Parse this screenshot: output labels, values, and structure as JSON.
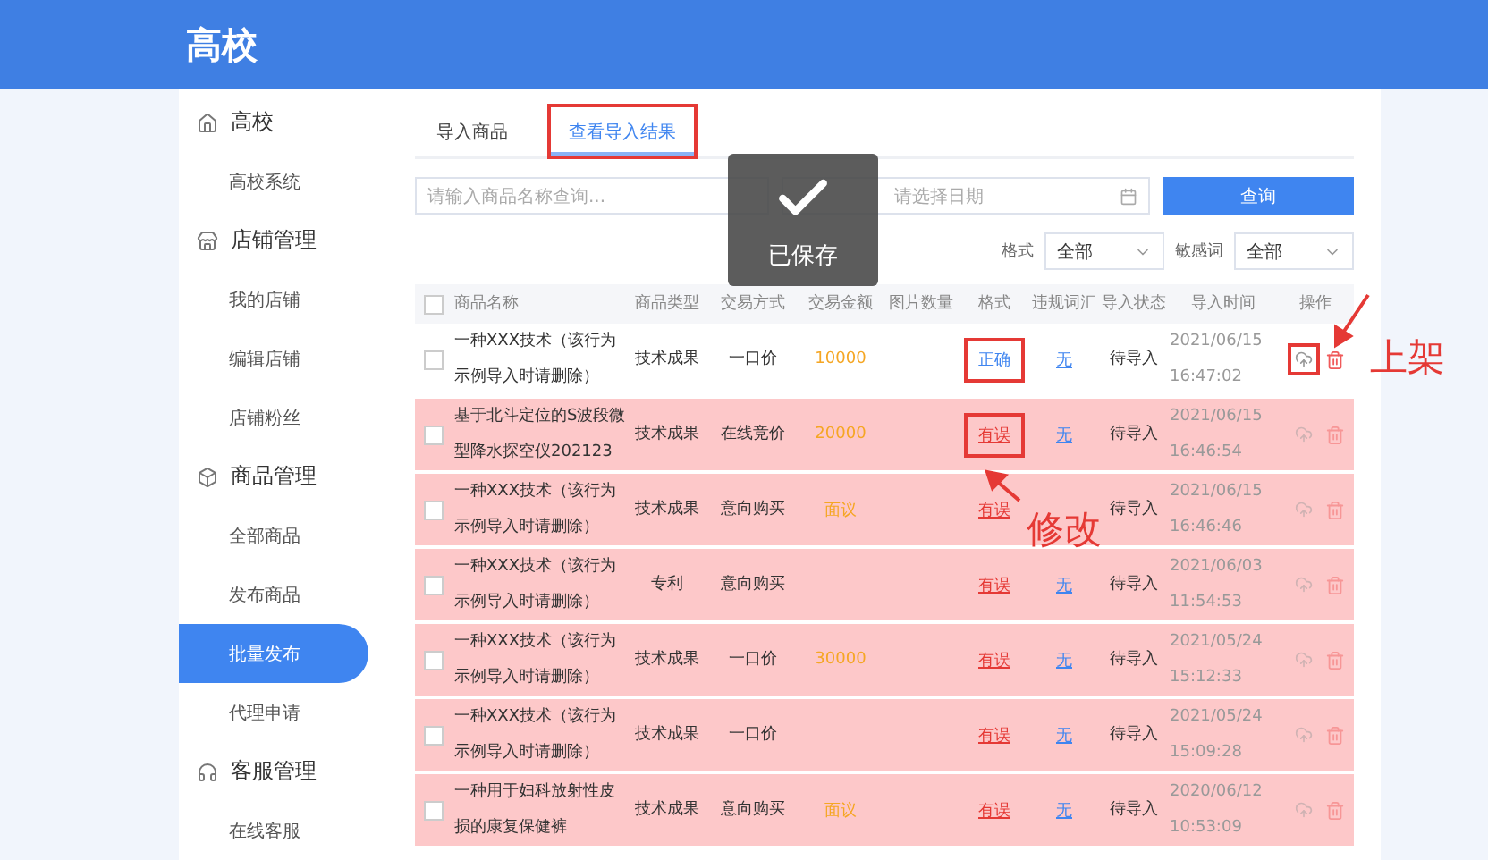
{
  "header": {
    "title": "高校"
  },
  "sidebar": [
    {
      "title": "高校",
      "children": [
        {
          "label": "高校系统",
          "selected": false
        }
      ]
    },
    {
      "title": "店铺管理",
      "children": [
        {
          "label": "我的店铺",
          "selected": false
        },
        {
          "label": "编辑店铺",
          "selected": false
        },
        {
          "label": "店铺粉丝",
          "selected": false
        }
      ]
    },
    {
      "title": "商品管理",
      "children": [
        {
          "label": "全部商品",
          "selected": false
        },
        {
          "label": "发布商品",
          "selected": false
        },
        {
          "label": "批量发布",
          "selected": true
        },
        {
          "label": "代理申请",
          "selected": false
        }
      ]
    },
    {
      "title": "客服管理",
      "children": [
        {
          "label": "在线客服",
          "selected": false
        }
      ]
    }
  ],
  "tabs": [
    {
      "label": "导入商品",
      "selected": false,
      "highlighted": false
    },
    {
      "label": "查看导入结果",
      "selected": true,
      "highlighted": true
    }
  ],
  "search": {
    "placeholder": "请输入商品名称查询..."
  },
  "date": {
    "placeholder": "请选择日期"
  },
  "query_button": "查询",
  "filters": [
    {
      "label": "格式",
      "value": "全部"
    },
    {
      "label": "敏感词",
      "value": "全部"
    }
  ],
  "toast": {
    "text": "已保存"
  },
  "table": {
    "select_all": {
      "checked": false
    },
    "columns": [
      "商品名称",
      "商品类型",
      "交易方式",
      "交易金额",
      "图片数量",
      "格式",
      "违规词汇",
      "导入状态",
      "导入时间",
      "操作"
    ],
    "rows": [
      {
        "name": "一种XXX技术（该行为示例导入时请删除）",
        "type": "技术成果",
        "method": "一口价",
        "amount": "10000",
        "format": "正确",
        "invalid": false,
        "words": "无",
        "status": "待导入",
        "time": "2021/06/15 16:47:02",
        "format_highlighted": true,
        "action_highlighted": true
      },
      {
        "name": "基于北斗定位的S波段微型降水探空仪202123",
        "type": "技术成果",
        "method": "在线竞价",
        "amount": "20000",
        "format": "有误",
        "invalid": true,
        "words": "无",
        "status": "待导入",
        "time": "2021/06/15 16:46:54",
        "format_highlighted": true,
        "action_highlighted": false
      },
      {
        "name": "一种XXX技术（该行为示例导入时请删除）",
        "type": "技术成果",
        "method": "意向购买",
        "amount": "面议",
        "format": "有误",
        "invalid": true,
        "status": "待导入",
        "time": "2021/06/15 16:46:46",
        "format_highlighted": false,
        "action_highlighted": false
      },
      {
        "name": "一种XXX技术（该行为示例导入时请删除）",
        "type": "专利",
        "method": "意向购买",
        "format": "有误",
        "invalid": true,
        "words": "无",
        "status": "待导入",
        "time": "2021/06/03 11:54:53",
        "format_highlighted": false,
        "action_highlighted": false
      },
      {
        "name": "一种XXX技术（该行为示例导入时请删除）",
        "type": "技术成果",
        "method": "一口价",
        "amount": "30000",
        "format": "有误",
        "invalid": true,
        "words": "无",
        "status": "待导入",
        "time": "2021/05/24 15:12:33",
        "format_highlighted": false,
        "action_highlighted": false
      },
      {
        "name": "一种XXX技术（该行为示例导入时请删除）",
        "type": "技术成果",
        "method": "一口价",
        "format": "有误",
        "invalid": true,
        "words": "无",
        "status": "待导入",
        "time": "2021/05/24 15:09:28",
        "format_highlighted": false,
        "action_highlighted": false
      },
      {
        "name": "一种用于妇科放射性皮损的康复保健裤",
        "type": "技术成果",
        "method": "意向购买",
        "amount": "面议",
        "format": "有误",
        "invalid": true,
        "words": "无",
        "status": "待导入",
        "time": "2020/06/12 10:53:09",
        "format_highlighted": false,
        "action_highlighted": false
      }
    ]
  },
  "annotations": [
    {
      "text": "上架"
    },
    {
      "text": "修改"
    }
  ]
}
